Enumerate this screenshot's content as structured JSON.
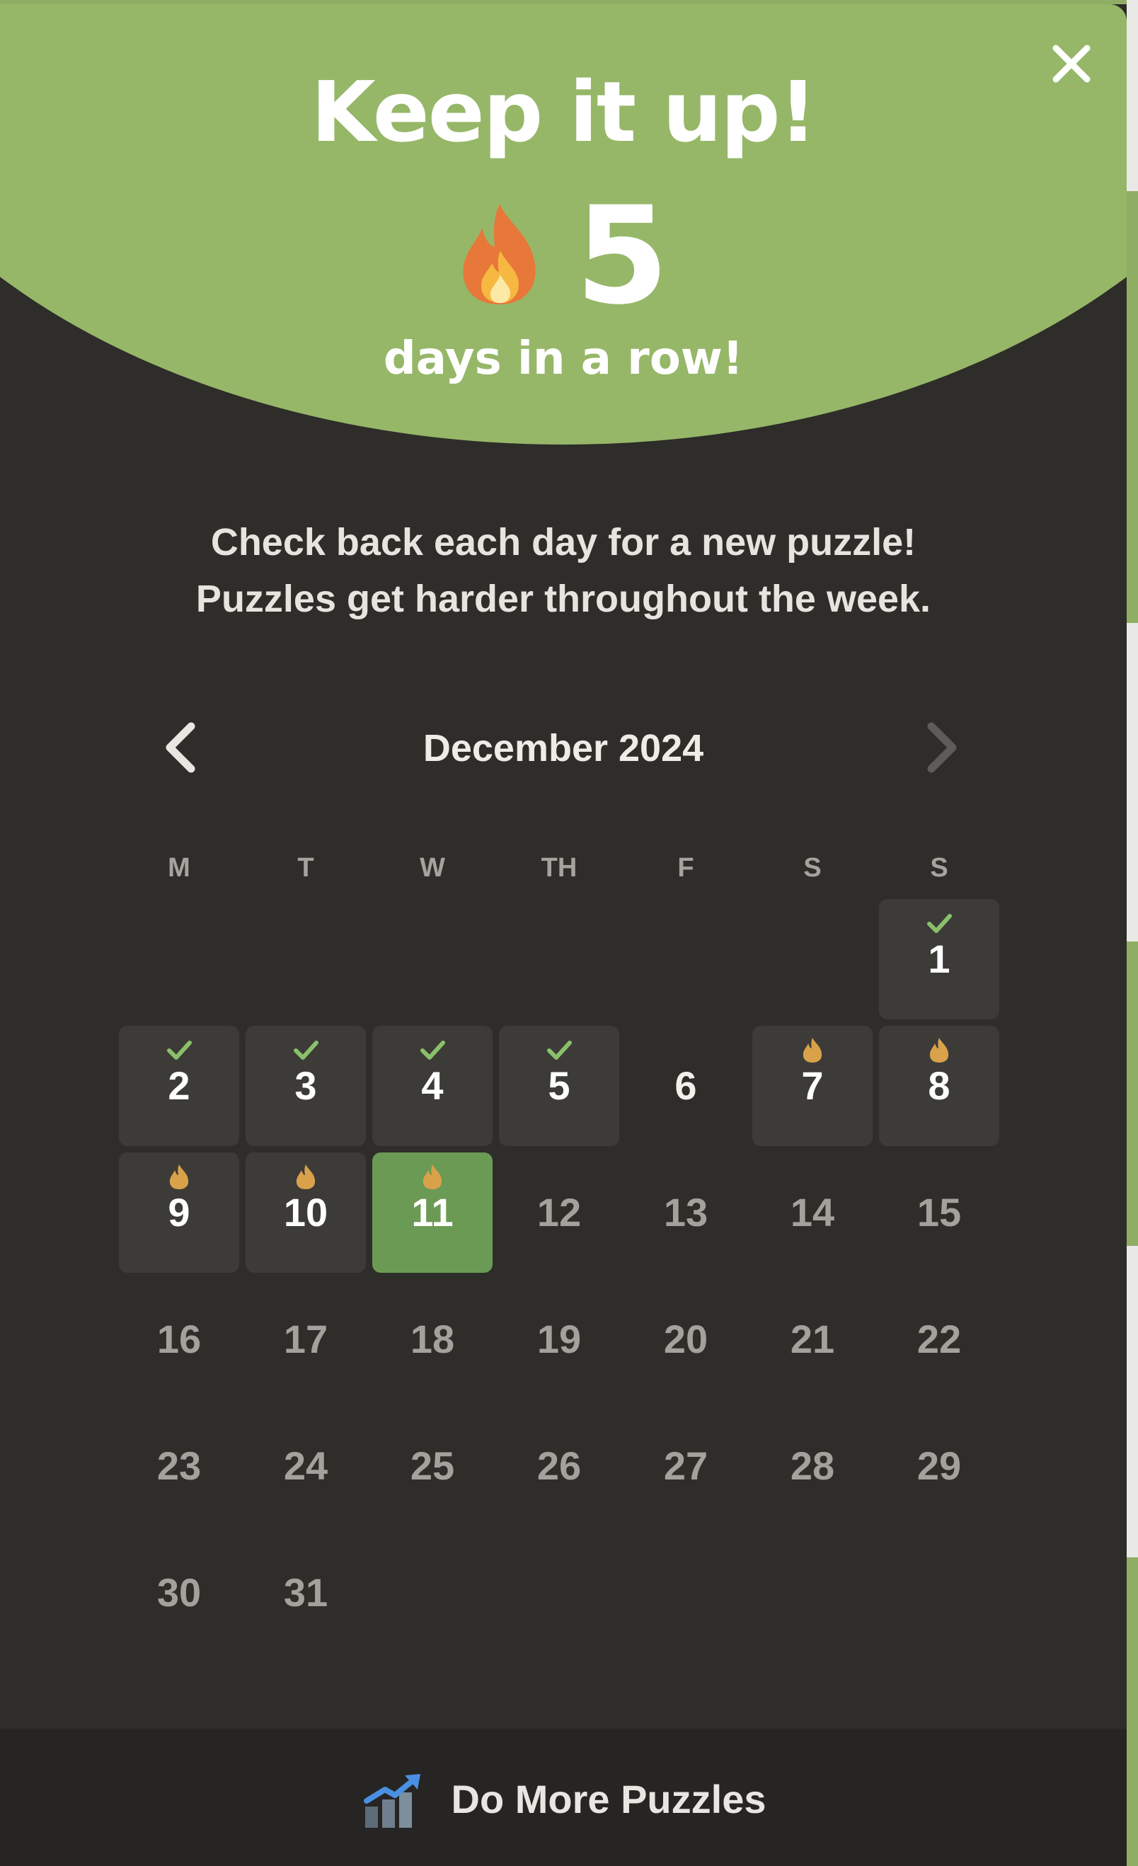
{
  "header": {
    "title": "Keep it up!",
    "streak_count": "5",
    "streak_label": "days in a row!"
  },
  "message": {
    "line1": "Check back each day for a new puzzle!",
    "line2": "Puzzles get harder throughout the week."
  },
  "calendar": {
    "month_label": "December 2024",
    "weekdays": [
      "M",
      "T",
      "W",
      "TH",
      "F",
      "S",
      "S"
    ],
    "days": [
      {
        "day": "1",
        "status": "completed"
      },
      {
        "day": "2",
        "status": "completed"
      },
      {
        "day": "3",
        "status": "completed"
      },
      {
        "day": "4",
        "status": "completed"
      },
      {
        "day": "5",
        "status": "completed"
      },
      {
        "day": "6",
        "status": "missed"
      },
      {
        "day": "7",
        "status": "streak"
      },
      {
        "day": "8",
        "status": "streak"
      },
      {
        "day": "9",
        "status": "streak"
      },
      {
        "day": "10",
        "status": "streak"
      },
      {
        "day": "11",
        "status": "today"
      },
      {
        "day": "12",
        "status": "future"
      },
      {
        "day": "13",
        "status": "future"
      },
      {
        "day": "14",
        "status": "future"
      },
      {
        "day": "15",
        "status": "future"
      },
      {
        "day": "16",
        "status": "future"
      },
      {
        "day": "17",
        "status": "future"
      },
      {
        "day": "18",
        "status": "future"
      },
      {
        "day": "19",
        "status": "future"
      },
      {
        "day": "20",
        "status": "future"
      },
      {
        "day": "21",
        "status": "future"
      },
      {
        "day": "22",
        "status": "future"
      },
      {
        "day": "23",
        "status": "future"
      },
      {
        "day": "24",
        "status": "future"
      },
      {
        "day": "25",
        "status": "future"
      },
      {
        "day": "26",
        "status": "future"
      },
      {
        "day": "27",
        "status": "future"
      },
      {
        "day": "28",
        "status": "future"
      },
      {
        "day": "29",
        "status": "future"
      },
      {
        "day": "30",
        "status": "future"
      },
      {
        "day": "31",
        "status": "future"
      }
    ]
  },
  "footer": {
    "label": "Do More Puzzles",
    "icon": "trending-chart-icon"
  },
  "icons": {
    "close": "close-icon",
    "flame": "flame-icon",
    "prev": "chevron-left-icon",
    "next": "chevron-right-icon",
    "check": "check-icon"
  },
  "colors": {
    "header_green": "#96b768",
    "today_green": "#6b9a55",
    "check_green": "#8bc06a",
    "flame_orange": "#d9a24a",
    "background": "#2e2d2a",
    "cell_bg": "#3c3b38"
  }
}
